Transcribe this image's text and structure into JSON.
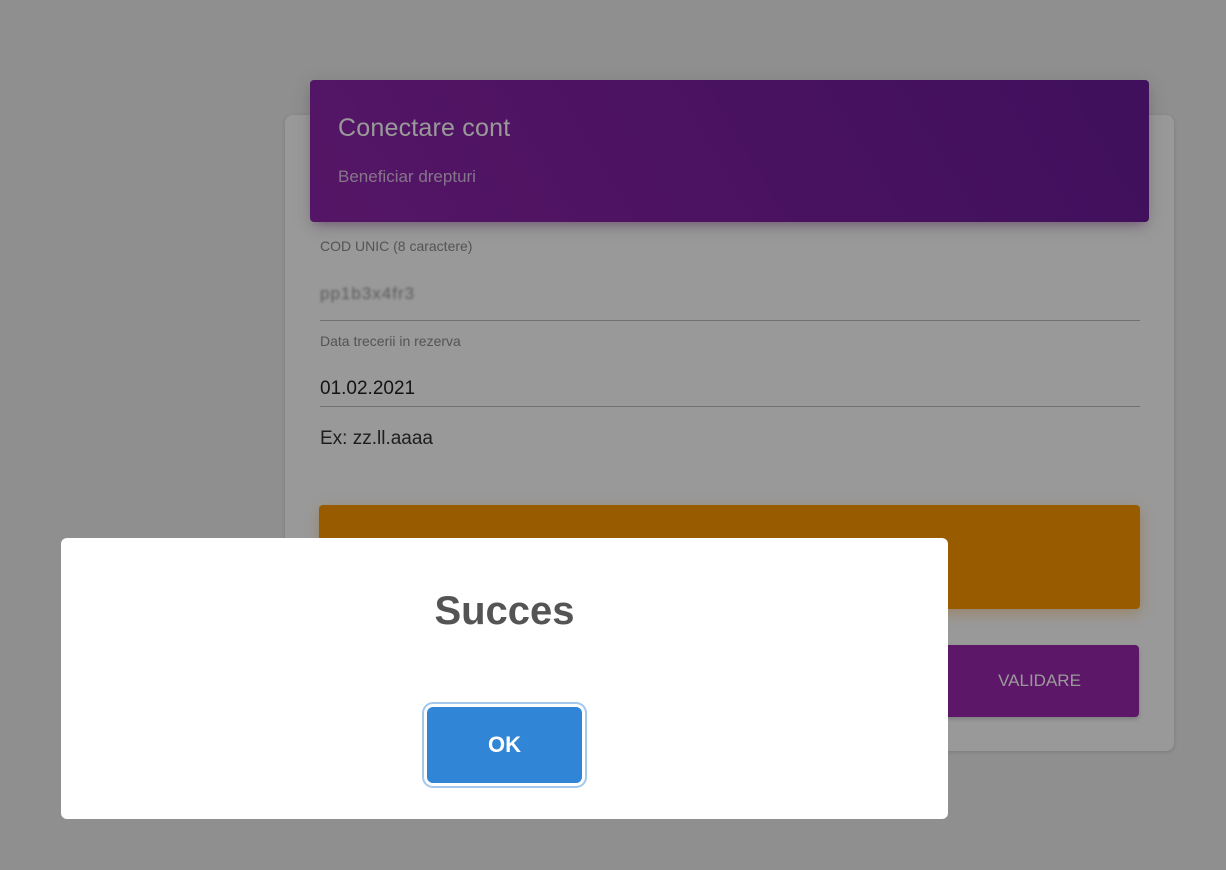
{
  "card": {
    "title": "Conectare cont",
    "subtitle": "Beneficiar drepturi"
  },
  "form": {
    "code_label": "COD UNIC (8 caractere)",
    "code_value_masked": "pp1b3x4fr3",
    "date_label": "Data trecerii in rezerva",
    "date_value": "01.02.2021",
    "date_hint": "Ex: zz.ll.aaaa",
    "validate_label": "VALIDARE"
  },
  "dialog": {
    "title": "Succes",
    "ok_label": "OK"
  },
  "colors": {
    "header_purple": "#8e24aa",
    "warning_orange": "#ff9800",
    "validate_purple": "#9c27b0",
    "ok_blue": "#3085d6"
  }
}
